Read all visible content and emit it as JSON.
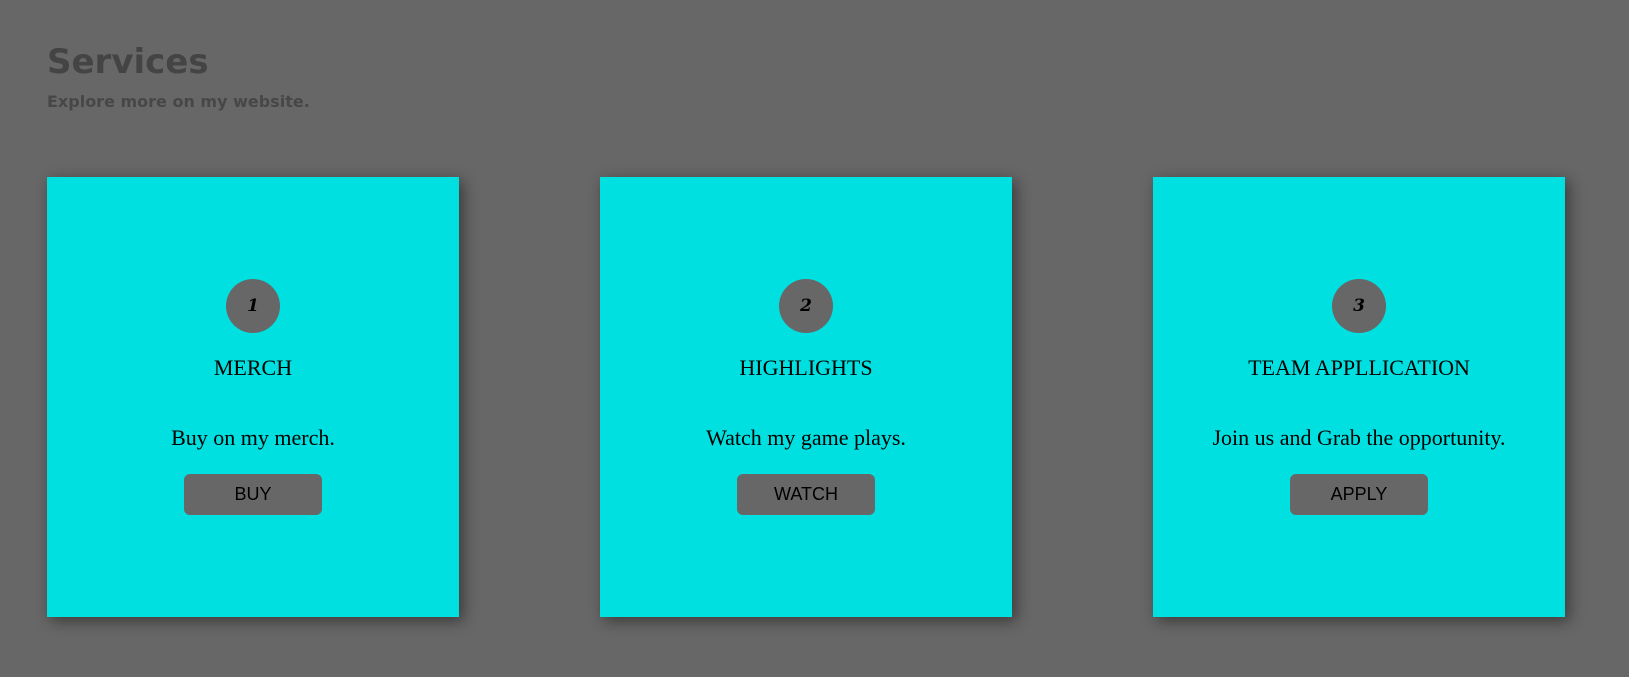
{
  "header": {
    "title": "Services",
    "subtitle": "Explore more on my website."
  },
  "colors": {
    "background": "#676767",
    "card": "#00e0e0",
    "button": "#676767",
    "badge": "#676767"
  },
  "cards": [
    {
      "number": "1",
      "title": "MERCH",
      "text": "Buy on my merch.",
      "button": "BUY"
    },
    {
      "number": "2",
      "title": "HIGHLIGHTS",
      "text": "Watch my game plays.",
      "button": "WATCH"
    },
    {
      "number": "3",
      "title": "TEAM APPLLICATION",
      "text": "Join us and Grab the opportunity.",
      "button": "APPLY"
    }
  ]
}
